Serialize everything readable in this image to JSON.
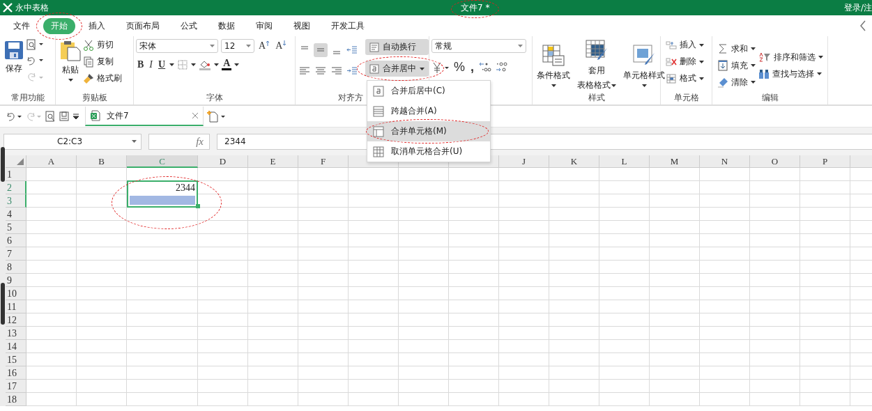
{
  "app": {
    "title": "永中表格",
    "document_title": {
      "text": "文件7 *",
      "circled": true
    },
    "account": "登录/注"
  },
  "menu_tabs": [
    {
      "label": "文件",
      "selected": false,
      "circled": false
    },
    {
      "label": "开始",
      "selected": true,
      "circled": true
    },
    {
      "label": "插入",
      "selected": false,
      "circled": false
    },
    {
      "label": "页面布局",
      "selected": false,
      "circled": false
    },
    {
      "label": "公式",
      "selected": false,
      "circled": false
    },
    {
      "label": "数据",
      "selected": false,
      "circled": false
    },
    {
      "label": "审阅",
      "selected": false,
      "circled": false
    },
    {
      "label": "视图",
      "selected": false,
      "circled": false
    },
    {
      "label": "开发工具",
      "selected": false,
      "circled": false
    }
  ],
  "ribbon": {
    "common": {
      "label": "常用功能",
      "save": "保存"
    },
    "clipboard": {
      "label": "剪贴板",
      "paste": "粘贴",
      "cut": "剪切",
      "copy": "复制",
      "format_painter": "格式刷"
    },
    "font": {
      "label": "字体",
      "family": "宋体",
      "size": "12",
      "grow": "A",
      "shrink": "A",
      "bold": "B",
      "italic": "I",
      "underline": "U",
      "font_color": "A"
    },
    "alignment": {
      "label": "对齐方",
      "vertical": [
        {
          "selected": false
        },
        {
          "selected": true
        },
        {
          "selected": false
        }
      ],
      "wrap_text": {
        "label": "自动换行",
        "on": true
      },
      "merge_center": {
        "label": "合并居中",
        "open": true,
        "circled": true
      }
    },
    "number": {
      "format": "常规",
      "percent": "%",
      "comma": ","
    },
    "styles": {
      "label": "样式",
      "conditional": "条件格式",
      "table_format": [
        "套用",
        "表格格式"
      ],
      "cell_style": "单元格样式"
    },
    "cells": {
      "label": "单元格",
      "insert": "插入",
      "delete": "删除",
      "format": "格式"
    },
    "editing": {
      "label": "编辑",
      "sum": "求和",
      "sort_filter": "排序和筛选",
      "fill": "填充",
      "find_select": "查找与选择",
      "clear": "清除"
    }
  },
  "merge_menu": [
    {
      "label": "合并后居中(C)",
      "selected": false,
      "circled": false
    },
    {
      "label": "跨越合并(A)",
      "selected": false,
      "circled": false
    },
    {
      "label": "合并单元格(M)",
      "selected": true,
      "circled": true
    },
    {
      "label": "取消单元格合并(U)",
      "selected": false,
      "circled": false
    }
  ],
  "doc_tabs": [
    {
      "label": "文件7",
      "selected": true
    }
  ],
  "formula_bar": {
    "name_box": "C2:C3",
    "function_label": "fx",
    "value": "2344"
  },
  "sheet": {
    "selection_circled": true,
    "columns": [
      {
        "label": "A",
        "selected": false
      },
      {
        "label": "B",
        "selected": false
      },
      {
        "label": "C",
        "selected": true
      },
      {
        "label": "D",
        "selected": false
      },
      {
        "label": "E",
        "selected": false
      },
      {
        "label": "F",
        "selected": false
      },
      {
        "selected": false
      },
      {
        "selected": false
      },
      {
        "selected": false
      },
      {
        "label": "J",
        "selected": false
      },
      {
        "label": "K",
        "selected": false
      },
      {
        "label": "L",
        "selected": false
      },
      {
        "label": "M",
        "selected": false
      },
      {
        "label": "N",
        "selected": false
      },
      {
        "label": "O",
        "selected": false
      },
      {
        "label": "P",
        "selected": false
      }
    ],
    "rows": [
      {
        "label": "1",
        "selected": false
      },
      {
        "label": "2",
        "selected": true,
        "cells": [
          {
            "kind": "blank"
          },
          {
            "kind": "blank"
          },
          {
            "kind": "number",
            "text": "2344"
          }
        ]
      },
      {
        "label": "3",
        "selected": true
      },
      {
        "label": "4",
        "selected": false
      },
      {
        "label": "5",
        "selected": false
      },
      {
        "label": "6",
        "selected": false
      },
      {
        "label": "7",
        "selected": false
      },
      {
        "label": "8",
        "selected": false
      },
      {
        "label": "9",
        "selected": false
      },
      {
        "label": "10",
        "selected": false
      },
      {
        "label": "11",
        "selected": false
      },
      {
        "label": "12",
        "selected": false
      },
      {
        "label": "13",
        "selected": false
      },
      {
        "label": "14",
        "selected": false
      },
      {
        "label": "15",
        "selected": false
      },
      {
        "label": "16",
        "selected": false
      },
      {
        "label": "17",
        "selected": false
      },
      {
        "label": "18",
        "selected": false
      }
    ]
  }
}
